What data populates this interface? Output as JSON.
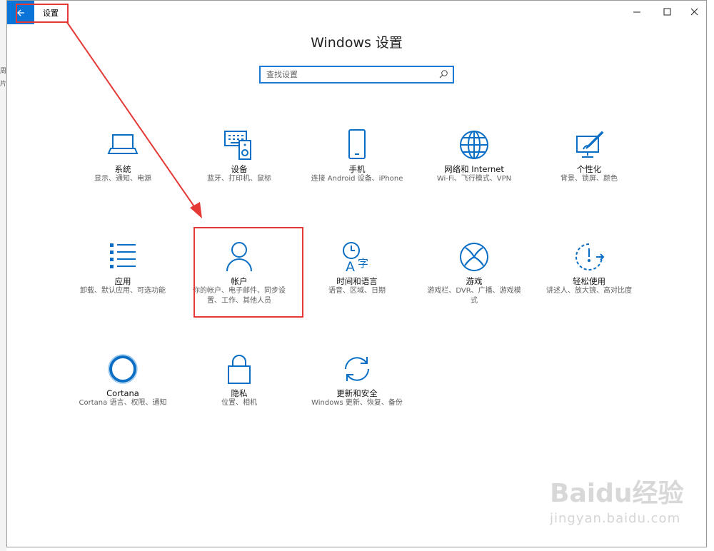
{
  "window": {
    "title": "设置",
    "back_icon": "back-arrow-icon"
  },
  "window_controls": {
    "minimize": "—",
    "maximize": "☐",
    "close": "✕"
  },
  "page_title": "Windows 设置",
  "search": {
    "placeholder": "查找设置",
    "icon": "search-icon"
  },
  "tiles": [
    {
      "label": "系统",
      "desc": "显示、通知、电源",
      "icon": "laptop-icon"
    },
    {
      "label": "设备",
      "desc": "蓝牙、打印机、鼠标",
      "icon": "keyboard-speaker-icon"
    },
    {
      "label": "手机",
      "desc": "连接 Android 设备、iPhone",
      "icon": "phone-icon"
    },
    {
      "label": "网络和 Internet",
      "desc": "Wi-Fi、飞行模式、VPN",
      "icon": "globe-icon"
    },
    {
      "label": "个性化",
      "desc": "背景、锁屏、颜色",
      "icon": "paint-tablet-icon"
    },
    {
      "label": "应用",
      "desc": "卸载、默认应用、可选功能",
      "icon": "app-list-icon"
    },
    {
      "label": "帐户",
      "desc": "你的帐户、电子邮件、同步设置、工作、其他人员",
      "icon": "person-icon"
    },
    {
      "label": "时间和语言",
      "desc": "语音、区域、日期",
      "icon": "time-language-icon"
    },
    {
      "label": "游戏",
      "desc": "游戏栏、DVR、广播、游戏模式",
      "icon": "xbox-icon"
    },
    {
      "label": "轻松使用",
      "desc": "讲述人、放大镜、高对比度",
      "icon": "ease-of-access-icon"
    },
    {
      "label": "Cortana",
      "desc": "Cortana 语言、权限、通知",
      "icon": "cortana-icon"
    },
    {
      "label": "隐私",
      "desc": "位置、相机",
      "icon": "lock-icon"
    },
    {
      "label": "更新和安全",
      "desc": "Windows 更新、恢复、备份",
      "icon": "sync-icon"
    }
  ],
  "watermark": {
    "logo": "Baidu经验",
    "url": "jingyan.baidu.com"
  },
  "colors": {
    "accent": "#0a74d8",
    "annotation": "#e53935",
    "icon": "#0a6fc4"
  }
}
